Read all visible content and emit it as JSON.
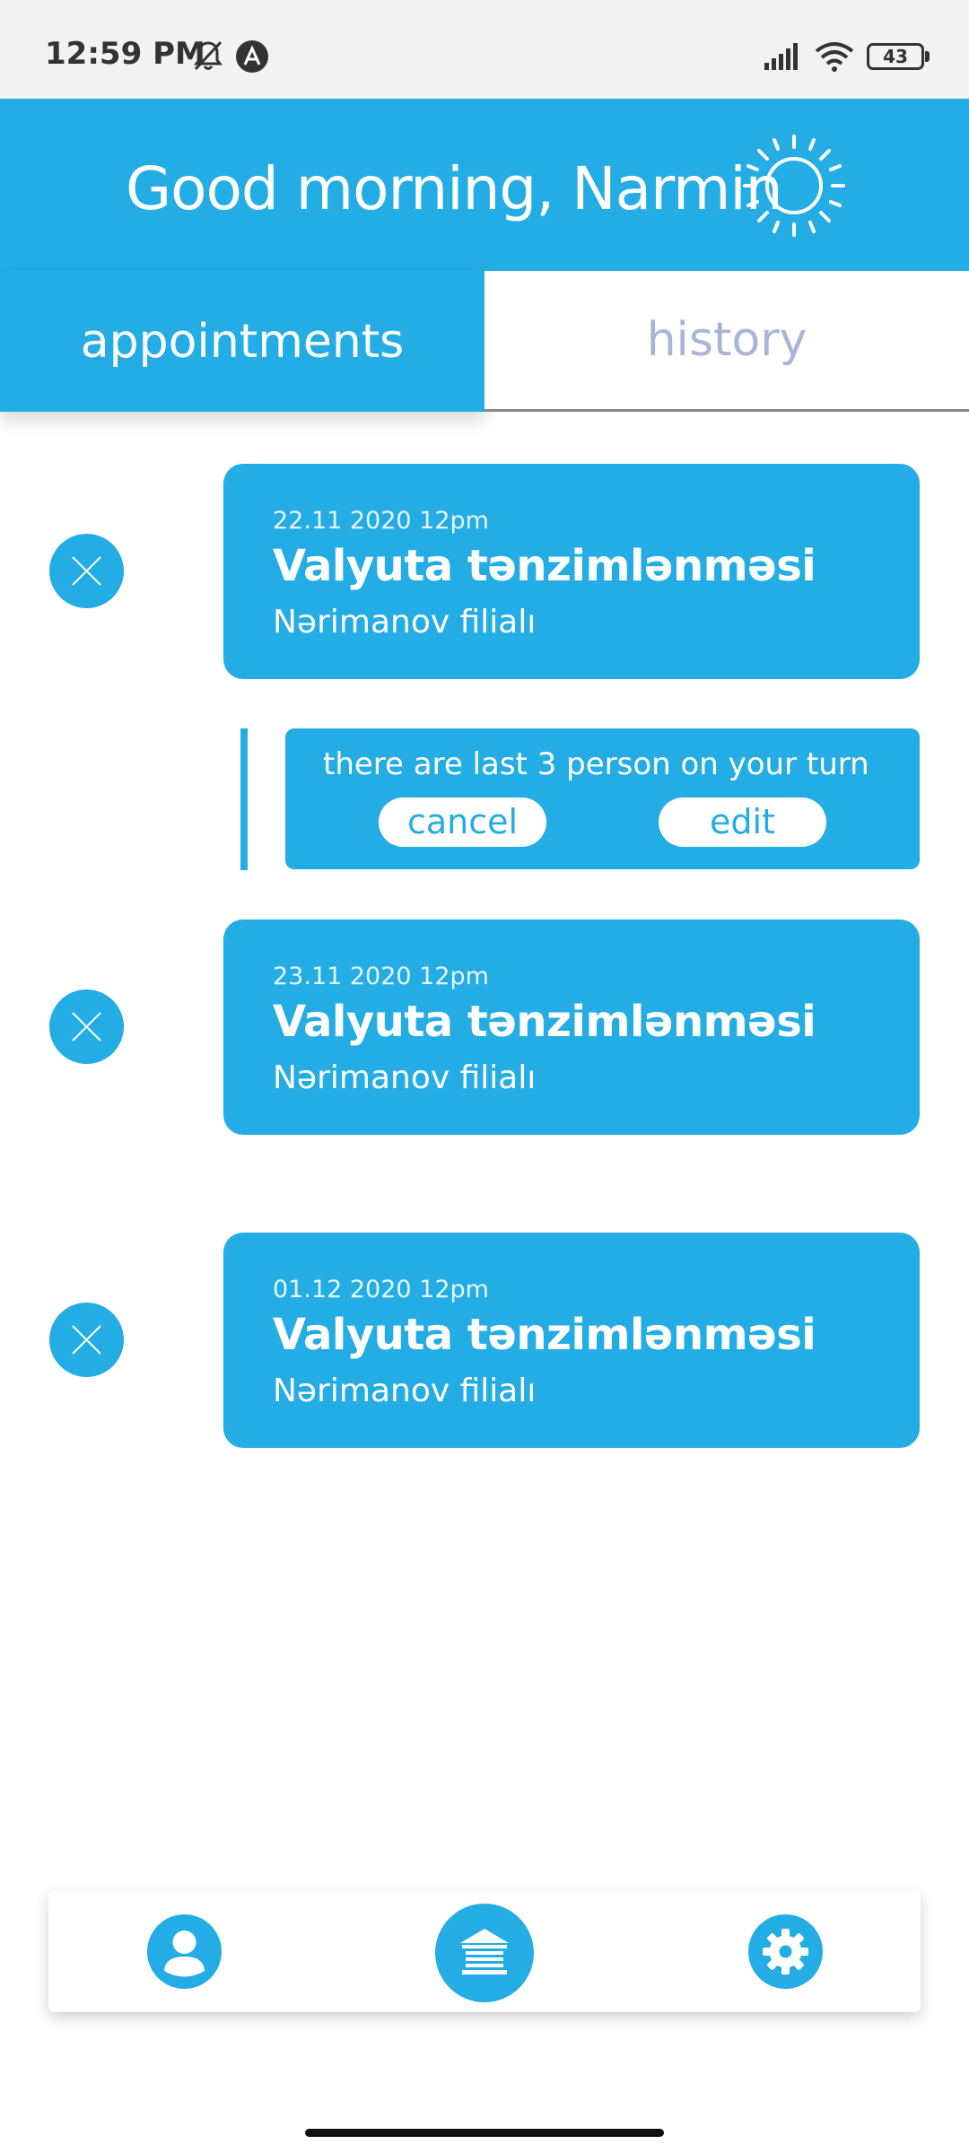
{
  "status_bar": {
    "time": "12:59 PM",
    "battery": "43",
    "icons": [
      "bell-off-icon",
      "app-notification-icon",
      "signal-icon",
      "wifi-icon",
      "battery-icon"
    ]
  },
  "header": {
    "greeting": "Good morning, Narmin",
    "icon": "sun-icon"
  },
  "tabs": [
    {
      "label": "appointments",
      "active": true
    },
    {
      "label": "history",
      "active": false
    }
  ],
  "appointments": [
    {
      "date": "22.11 2020 12pm",
      "title": "Valyuta tənzimlənməsi",
      "branch": "Nərimanov filialı"
    },
    {
      "date": "23.11 2020 12pm",
      "title": "Valyuta tənzimlənməsi",
      "branch": "Nərimanov filialı"
    },
    {
      "date": "01.12 2020 12pm",
      "title": "Valyuta tənzimlənməsi",
      "branch": "Nərimanov filialı"
    }
  ],
  "queue_notice": {
    "text": "there are last 3 person on your turn",
    "cancel_label": "cancel",
    "edit_label": "edit"
  },
  "bottom_nav": {
    "items": [
      "profile-icon",
      "bank-icon",
      "settings-icon"
    ]
  },
  "colors": {
    "accent": "#23ade4",
    "inactive_tab_text": "#a9b5d8",
    "background": "#ffffff"
  }
}
